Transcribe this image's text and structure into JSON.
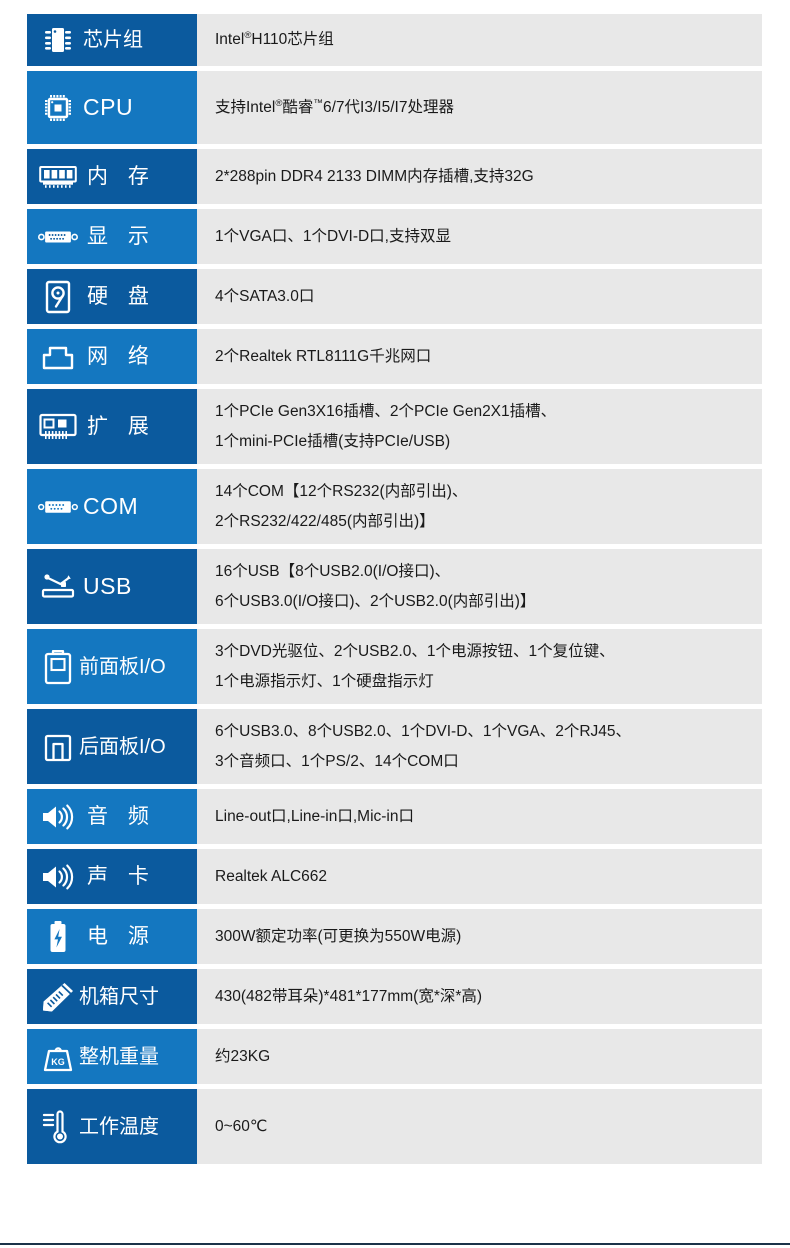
{
  "table": {
    "rows": [
      {
        "icon": "chipset-icon",
        "label": "芯片组",
        "label_style": "narrow",
        "shade": "dark",
        "height": "h-52",
        "lines": [
          "Intel®H110芯片组"
        ]
      },
      {
        "icon": "cpu-icon",
        "label": "CPU",
        "label_style": "latin",
        "shade": "light",
        "height": "h-73",
        "lines": [
          "支持Intel®酷睿™6/7代I3/I5/I7处理器"
        ]
      },
      {
        "icon": "memory-icon",
        "label": "内 存",
        "label_style": "spaced",
        "shade": "dark",
        "height": "h-55",
        "lines": [
          "2*288pin DDR4 2133 DIMM内存插槽,支持32G"
        ]
      },
      {
        "icon": "vga-display-icon",
        "label": "显 示",
        "label_style": "spaced",
        "shade": "light",
        "height": "h-55",
        "lines": [
          "1个VGA口、1个DVI-D口,支持双显"
        ]
      },
      {
        "icon": "harddisk-icon",
        "label": "硬 盘",
        "label_style": "spaced",
        "shade": "dark",
        "height": "h-55",
        "lines": [
          " 4个SATA3.0口"
        ]
      },
      {
        "icon": "network-rj45-icon",
        "label": "网 络",
        "label_style": "spaced",
        "shade": "light",
        "height": "h-55",
        "lines": [
          "2个Realtek RTL8111G千兆网口"
        ]
      },
      {
        "icon": "expansion-slot-icon",
        "label": "扩 展",
        "label_style": "spaced",
        "shade": "dark",
        "height": "h-75",
        "lines": [
          "1个PCIe Gen3X16插槽、2个PCIe Gen2X1插槽、",
          "1个mini-PCIe插槽(支持PCIe/USB)"
        ]
      },
      {
        "icon": "com-port-icon",
        "label": "COM",
        "label_style": "latin",
        "shade": "light",
        "height": "h-75",
        "lines": [
          "14个COM【12个RS232(内部引出)、",
          "2个RS232/422/485(内部引出)】"
        ]
      },
      {
        "icon": "usb-icon",
        "label": "USB",
        "label_style": "latin",
        "shade": "dark",
        "height": "h-75",
        "lines": [
          "16个USB【8个USB2.0(I/O接口)、",
          "6个USB3.0(I/O接口)、2个USB2.0(内部引出)】"
        ]
      },
      {
        "icon": "front-panel-icon",
        "label": "前面板I/O",
        "label_style": "tight",
        "shade": "light",
        "height": "h-75",
        "lines": [
          "3个DVD光驱位、2个USB2.0、1个电源按钮、1个复位键、",
          "1个电源指示灯、1个硬盘指示灯"
        ]
      },
      {
        "icon": "rear-panel-icon",
        "label": "后面板I/O",
        "label_style": "tight",
        "shade": "dark",
        "height": "h-75",
        "lines": [
          "6个USB3.0、8个USB2.0、1个DVI-D、1个VGA、2个RJ45、",
          "3个音频口、1个PS/2、14个COM口"
        ]
      },
      {
        "icon": "speaker-icon",
        "label": "音 频",
        "label_style": "spaced",
        "shade": "light",
        "height": "h-55",
        "lines": [
          "Line-out口,Line-in口,Mic-in口"
        ]
      },
      {
        "icon": "speaker-icon",
        "label": "声 卡",
        "label_style": "spaced",
        "shade": "dark",
        "height": "h-55",
        "lines": [
          "Realtek ALC662"
        ]
      },
      {
        "icon": "battery-power-icon",
        "label": "电 源",
        "label_style": "spaced",
        "shade": "light",
        "height": "h-55",
        "lines": [
          "300W额定功率(可更换为550W电源)"
        ]
      },
      {
        "icon": "ruler-pencil-icon",
        "label": "机箱尺寸",
        "label_style": "tight",
        "shade": "dark",
        "height": "h-55",
        "lines": [
          "430(482带耳朵)*481*177mm(宽*深*高)"
        ]
      },
      {
        "icon": "weight-kg-icon",
        "label": "整机重量",
        "label_style": "tight",
        "shade": "light",
        "height": "h-55",
        "lines": [
          "约23KG"
        ]
      },
      {
        "icon": "thermometer-icon",
        "label": "工作温度",
        "label_style": "tight",
        "shade": "dark",
        "height": "h-75",
        "lines": [
          "0~60℃"
        ]
      }
    ]
  },
  "colors": {
    "label_dark": "#0B5A9E",
    "label_light": "#1477C0",
    "value_bg": "#E8E8E8",
    "value_text": "#1a1a1a",
    "bottom_rule": "#1b3349"
  }
}
